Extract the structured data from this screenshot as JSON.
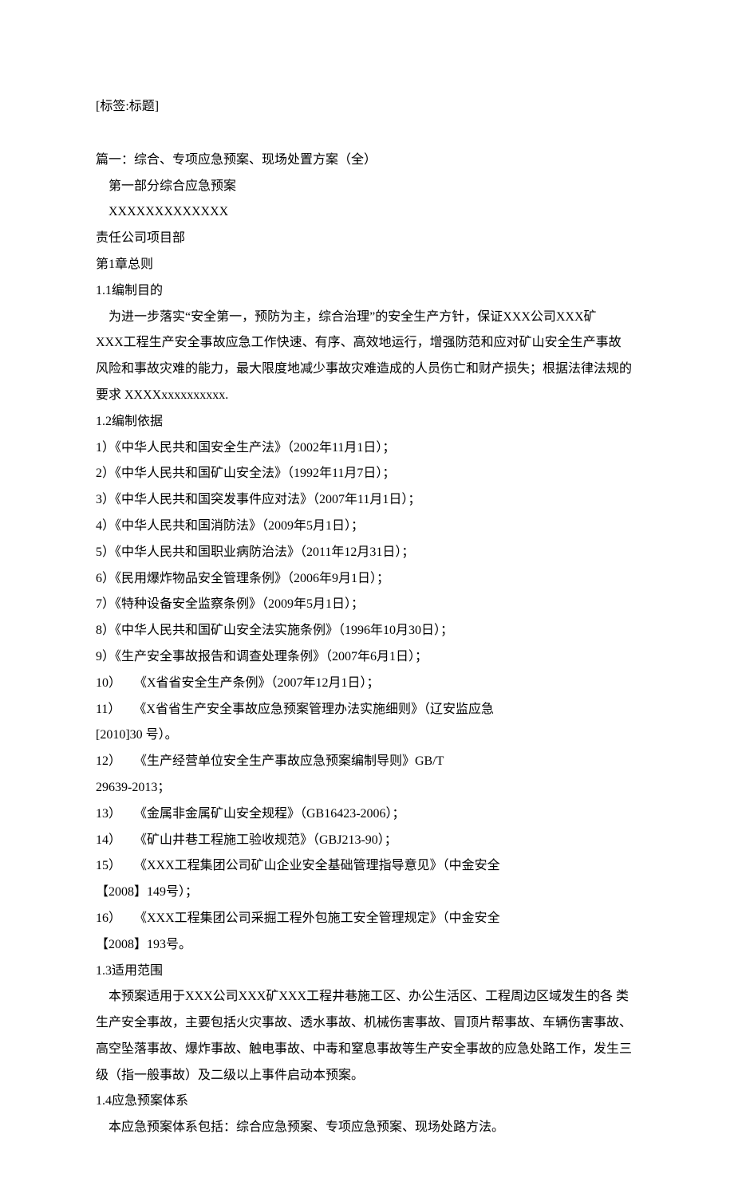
{
  "tag": "[标签:标题]",
  "lines": {
    "l1": "篇一：综合、专项应急预案、现场处置方案（全）",
    "l2": "第一部分综合应急预案",
    "l3": "XXXXXXXXXXXXX",
    "l4": "责任公司项目部",
    "l5": "第1章总则",
    "l6": "1.1编制目的",
    "p1a": "　为进一步落实“安全第一，预防为主，综合治理”的安全生产方针，保证XXX公司XXX矿",
    "p1b": "XXX工程生产安全事故应急工作快速、有序、高效地运行，增强防范和应对矿山安全生产事故",
    "p1c": "风险和事故灾难的能力，最大限度地减少事故灾难造成的人员伤亡和财产损失；根据法律法规的",
    "p1d": "要求  XXXXxxxxxxxxxx.",
    "l7": "1.2编制依据",
    "r1": "1）《中华人民共和国安全生产法》（2002年11月1日）；",
    "r2": "2）《中华人民共和国矿山安全法》（1992年11月7日）；",
    "r3": "3）《中华人民共和国突发事件应对法》（2007年11月1日）；",
    "r4": "4）《中华人民共和国消防法》（2009年5月1日）；",
    "r5": "5）《中华人民共和国职业病防治法》（2011年12月31日）；",
    "r6": "6）《民用爆炸物品安全管理条例》（2006年9月1日）；",
    "r7": "7）《特种设备安全监察条例》（2009年5月1日）；",
    "r8": "8）《中华人民共和国矿山安全法实施条例》（1996年10月30日）；",
    "r9": "9）《生产安全事故报告和调查处理条例》（2007年6月1日）；",
    "r10": "10）　　《X省省安全生产条例》（2007年12月1日）；",
    "r11": "11）　　《X省省生产安全事故应急预案管理办法实施细则》（辽安监应急",
    "r11b": "[2010]30 号）。",
    "r12": "12）　　《生产经营单位安全生产事故应急预案编制导则》GB/T",
    "r12b": "29639-2013；",
    "r13": "13）　　《金属非金属矿山安全规程》（GB16423-2006）；",
    "r14": "14）　　《矿山井巷工程施工验收规范》（GBJ213-90）；",
    "r15": "15）　　《XXX工程集团公司矿山企业安全基础管理指导意见》（中金安全",
    "r15b": "【2008】149号）；",
    "r16": "16）　　《XXX工程集团公司采掘工程外包施工安全管理规定》（中金安全",
    "r16b": "【2008】193号。",
    "l8": "1.3适用范围",
    "p2a": "　本预案适用于XXX公司XXX矿XXX工程井巷施工区、办公生活区、工程周边区域发生的各 类",
    "p2b": "生产安全事故，主要包括火灾事故、透水事故、机械伤害事故、冒顶片帮事故、车辆伤害事故、",
    "p2c": "高空坠落事故、爆炸事故、触电事故、中毒和窒息事故等生产安全事故的应急处路工作，发生三",
    "p2d": "级（指一般事故）及二级以上事件启动本预案。",
    "l9": "1.4应急预案体系",
    "p3": "　本应急预案体系包括：综合应急预案、专项应急预案、现场处路方法。"
  }
}
